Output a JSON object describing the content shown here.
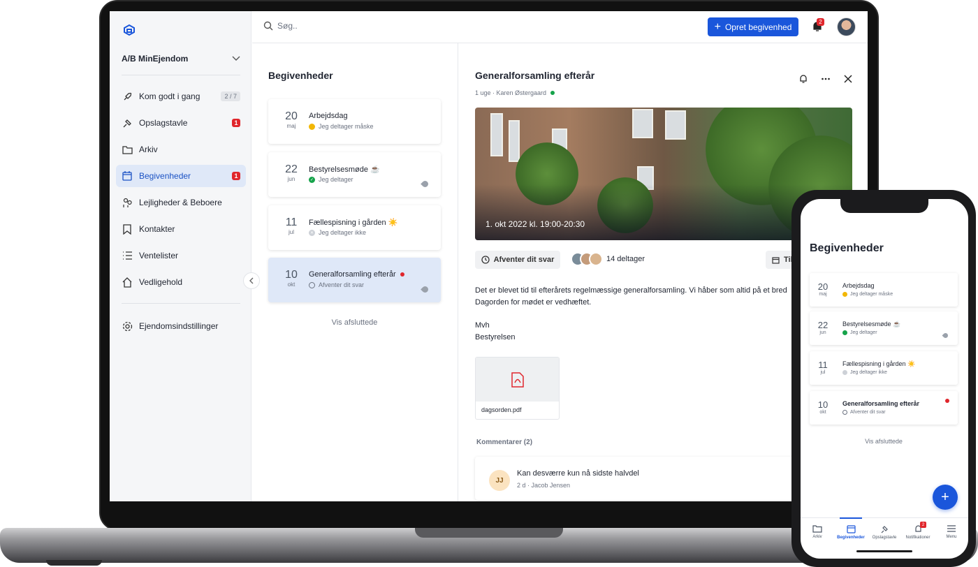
{
  "sidebar": {
    "property_name": "A/B MinEjendom",
    "items": [
      {
        "label": "Kom godt i gang",
        "count": "2 / 7",
        "icon": "rocket-icon"
      },
      {
        "label": "Opslagstavle",
        "badge": "1",
        "icon": "pin-icon"
      },
      {
        "label": "Arkiv",
        "icon": "folder-icon"
      },
      {
        "label": "Begivenheder",
        "badge": "1",
        "icon": "calendar-icon",
        "active": true
      },
      {
        "label": "Lejligheder & Beboere",
        "icon": "residents-icon"
      },
      {
        "label": "Kontakter",
        "icon": "bookmark-icon"
      },
      {
        "label": "Ventelister",
        "icon": "list-icon"
      },
      {
        "label": "Vedligehold",
        "icon": "house-tools-icon"
      }
    ],
    "settings_label": "Ejendomsindstillinger"
  },
  "topbar": {
    "search_placeholder": "Søg..",
    "create_label": "Opret begivenhed",
    "notification_count": "2"
  },
  "list": {
    "title": "Begivenheder",
    "events": [
      {
        "day": "20",
        "month": "maj",
        "name": "Arbejdsdag",
        "status": "Jeg deltager måske"
      },
      {
        "day": "22",
        "month": "jun",
        "name": "Bestyrelsesmøde ☕",
        "status": "Jeg deltager"
      },
      {
        "day": "11",
        "month": "jul",
        "name": "Fællespisning i gården ☀️",
        "status": "Jeg deltager ikke"
      },
      {
        "day": "10",
        "month": "okt",
        "name": "Generalforsamling efterår",
        "status": "Afventer dit svar"
      }
    ],
    "show_done": "Vis afsluttede"
  },
  "detail": {
    "title": "Generalforsamling efterår",
    "meta": "1 uge · Karen Østergaard",
    "hero_date": "1. okt 2022 kl. 19:00-20:30",
    "rsvp_label": "Afventer dit svar",
    "participants": "14 deltager",
    "calendar_label": "Til",
    "body_line1": "Det er blevet tid til efterårets regelmæssige generalforsamling. Vi håber som altid på et bred",
    "body_line2": "Dagorden for mødet er vedhæftet.",
    "body_line3": "Mvh",
    "body_line4": "Bestyrelsen",
    "attachment": "dagsorden.pdf",
    "comments_label": "Kommentarer (2)",
    "comment": {
      "initials": "JJ",
      "text": "Kan desværre kun nå sidste halvdel",
      "meta": "2 d · Jacob Jensen"
    }
  },
  "phone": {
    "title": "Begivenheder",
    "show_done": "Vis afsluttede",
    "tabs": [
      {
        "label": "Arkiv",
        "icon": "folder-icon"
      },
      {
        "label": "Begivenheder",
        "icon": "calendar-icon",
        "active": true
      },
      {
        "label": "Opslagstavle",
        "icon": "pin-icon"
      },
      {
        "label": "Notifikationer",
        "icon": "bell-icon",
        "badge": "2"
      },
      {
        "label": "Menu",
        "icon": "menu-icon"
      }
    ]
  },
  "colors": {
    "accent": "#1a56db",
    "badge_red": "#e0262c",
    "active_bg": "#dfe8f8"
  }
}
